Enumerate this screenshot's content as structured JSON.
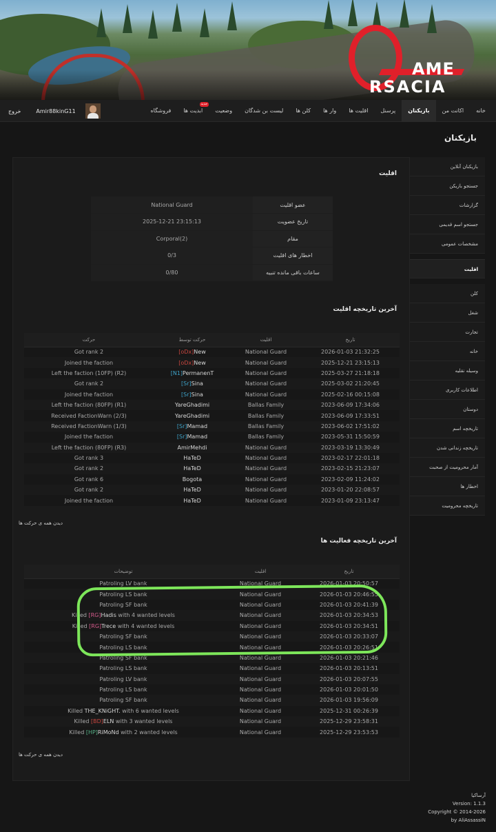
{
  "header": {
    "logo_line1": "AME",
    "logo_line2": "RSACIA"
  },
  "nav": {
    "items": [
      {
        "label": "خانه"
      },
      {
        "label": "اکانت من"
      },
      {
        "label": "بازیکنان",
        "active": true
      },
      {
        "label": "پرسنل"
      },
      {
        "label": "اقلیت ها"
      },
      {
        "label": "وار ها"
      },
      {
        "label": "کلن ها"
      },
      {
        "label": "لیست بن شدگان"
      },
      {
        "label": "وضعیت"
      },
      {
        "label": "ابدیت ها",
        "badge": "جدید"
      },
      {
        "label": "فروشگاه"
      }
    ],
    "username": "Amir88kinG11",
    "logout": "خروج"
  },
  "page_title": "بازیکنان",
  "sidebar": {
    "items_top": [
      "بازیکنان آنلاین",
      "جستجو بازیکن",
      "گزارشات",
      "جستجو اسم قدیمی",
      "مشخصات عمومی"
    ],
    "active": "اقلیت",
    "items_bottom": [
      "کلن",
      "شغل",
      "تجارت",
      "خانه",
      "وسیله نقلیه",
      "اطلاعات کاربری",
      "دوستان",
      "تاریخچه اسم",
      "تاریخچه زندانی شدن",
      "آمار محرومیت از صحبت",
      "اخطار ها",
      "تاریخچه محرومیت"
    ]
  },
  "faction": {
    "title": "اقلیت",
    "rows": [
      {
        "key": "عضو اقلیت",
        "value": "National Guard"
      },
      {
        "key": "تاریخ عضویت",
        "value": "2025-12-21 23:15:13"
      },
      {
        "key": "مقام",
        "value": "Corporal(2)"
      },
      {
        "key": "اخطار های اقلیت",
        "value": "0/3"
      },
      {
        "key": "ساعات باقی مانده تنبیه",
        "value": "0/80"
      }
    ]
  },
  "faction_history": {
    "title": "آخرین تاریخچه اقلیت",
    "headers": {
      "date": "تاریخ",
      "faction": "اقلیت",
      "by": "حرکت توسط",
      "action": "حرکت"
    },
    "rows": [
      {
        "date": "2026-01-03 21:32:25",
        "faction": "National Guard",
        "fc": "ng",
        "tag": "[oDx]",
        "tc": "tag-red",
        "name": "New",
        "action": "Got rank 2"
      },
      {
        "date": "2025-12-21 23:15:13",
        "faction": "National Guard",
        "fc": "ng",
        "tag": "[oDx]",
        "tc": "tag-red",
        "name": "New",
        "action": "Joined the faction"
      },
      {
        "date": "2025-03-27 21:18:18",
        "faction": "National Guard",
        "fc": "ng",
        "tag": "[N1]",
        "tc": "tag-cyan",
        "name": "PermanenT",
        "action": "Left the faction (10FP) (R2)"
      },
      {
        "date": "2025-03-02 21:20:45",
        "faction": "National Guard",
        "fc": "ng",
        "tag": "[Sr]",
        "tc": "tag-cyan",
        "name": "Sina",
        "action": "Got rank 2"
      },
      {
        "date": "2025-02-16 00:15:08",
        "faction": "National Guard",
        "fc": "ng",
        "tag": "[Sr]",
        "tc": "tag-cyan",
        "name": "Sina",
        "action": "Joined the faction"
      },
      {
        "date": "2023-06-09 17:34:06",
        "faction": "Ballas Family",
        "fc": "ballas",
        "tag": "",
        "tc": "",
        "name": "YareGhadimi",
        "action": "Left the faction (80FP) (R1)"
      },
      {
        "date": "2023-06-09 17:33:51",
        "faction": "Ballas Family",
        "fc": "ballas",
        "tag": "",
        "tc": "",
        "name": "YareGhadimi",
        "action": "Received FactionWarn (2/3)"
      },
      {
        "date": "2023-06-02 17:51:02",
        "faction": "Ballas Family",
        "fc": "ballas",
        "tag": "[Sr]",
        "tc": "tag-cyan",
        "name": "Mamad",
        "action": "Received FactionWarn (1/3)"
      },
      {
        "date": "2023-05-31 15:50:59",
        "faction": "Ballas Family",
        "fc": "ballas",
        "tag": "[Sr]",
        "tc": "tag-cyan",
        "name": "Mamad",
        "action": "Joined the faction"
      },
      {
        "date": "2023-03-19 13:30:49",
        "faction": "National Guard",
        "fc": "ng",
        "tag": "",
        "tc": "",
        "name": "AmirMehdi",
        "action": "Left the faction (80FP) (R3)"
      },
      {
        "date": "2023-02-17 22:01:18",
        "faction": "National Guard",
        "fc": "ng",
        "tag": "",
        "tc": "",
        "name": "HaTeD",
        "action": "Got rank 3"
      },
      {
        "date": "2023-02-15 21:23:07",
        "faction": "National Guard",
        "fc": "ng",
        "tag": "",
        "tc": "",
        "name": "HaTeD",
        "action": "Got rank 2"
      },
      {
        "date": "2023-02-09 11:24:02",
        "faction": "National Guard",
        "fc": "ng",
        "tag": "",
        "tc": "",
        "name": "Bogota",
        "action": "Got rank 6"
      },
      {
        "date": "2023-01-20 22:08:57",
        "faction": "National Guard",
        "fc": "ng",
        "tag": "",
        "tc": "",
        "name": "HaTeD",
        "action": "Got rank 2"
      },
      {
        "date": "2023-01-09 23:13:47",
        "faction": "National Guard",
        "fc": "ng",
        "tag": "",
        "tc": "",
        "name": "HaTeD",
        "action": "Joined the faction"
      }
    ],
    "see_all": "دیدن همه ی حرکت ها"
  },
  "activity_history": {
    "title": "آخرین تاریخچه فعالیت ها",
    "headers": {
      "date": "تاریخ",
      "faction": "اقلیت",
      "desc": "توضیحات"
    },
    "rows": [
      {
        "date": "2026-01-03 20:50:57",
        "faction": "National Guard",
        "pre": "Patroling LV bank",
        "tag": "",
        "tc": "",
        "name": "",
        "post": ""
      },
      {
        "date": "2026-01-03 20:46:55",
        "faction": "National Guard",
        "pre": "Patroling LS bank",
        "tag": "",
        "tc": "",
        "name": "",
        "post": ""
      },
      {
        "date": "2026-01-03 20:41:39",
        "faction": "National Guard",
        "pre": "Patroling SF bank",
        "tag": "",
        "tc": "",
        "name": "",
        "post": ""
      },
      {
        "date": "2026-01-03 20:34:53",
        "faction": "National Guard",
        "pre": "Killed ",
        "tag": "[RG]",
        "tc": "tag-pink",
        "name": "Hadis",
        "post": " with 4 wanted levels"
      },
      {
        "date": "2026-01-03 20:34:51",
        "faction": "National Guard",
        "pre": "Killed ",
        "tag": "[RG]",
        "tc": "tag-pink",
        "name": "Trece",
        "post": " with 4 wanted levels"
      },
      {
        "date": "2026-01-03 20:33:07",
        "faction": "National Guard",
        "pre": "Patroling SF bank",
        "tag": "",
        "tc": "",
        "name": "",
        "post": ""
      },
      {
        "date": "2026-01-03 20:26:51",
        "faction": "National Guard",
        "pre": "Patroling LS bank",
        "tag": "",
        "tc": "",
        "name": "",
        "post": ""
      },
      {
        "date": "2026-01-03 20:21:46",
        "faction": "National Guard",
        "pre": "Patroling SF bank",
        "tag": "",
        "tc": "",
        "name": "",
        "post": ""
      },
      {
        "date": "2026-01-03 20:13:51",
        "faction": "National Guard",
        "pre": "Patroling LS bank",
        "tag": "",
        "tc": "",
        "name": "",
        "post": ""
      },
      {
        "date": "2026-01-03 20:07:55",
        "faction": "National Guard",
        "pre": "Patroling LV bank",
        "tag": "",
        "tc": "",
        "name": "",
        "post": ""
      },
      {
        "date": "2026-01-03 20:01:50",
        "faction": "National Guard",
        "pre": "Patroling LS bank",
        "tag": "",
        "tc": "",
        "name": "",
        "post": ""
      },
      {
        "date": "2026-01-03 19:56:09",
        "faction": "National Guard",
        "pre": "Patroling SF bank",
        "tag": "",
        "tc": "",
        "name": "",
        "post": ""
      },
      {
        "date": "2025-12-31 00:26:39",
        "faction": "National Guard",
        "pre": "Killed ",
        "tag": "",
        "tc": "",
        "name": "THE_KNiGHT.",
        "post": " with 6 wanted levels"
      },
      {
        "date": "2025-12-29 23:58:31",
        "faction": "National Guard",
        "pre": "Killed ",
        "tag": "[BD]",
        "tc": "tag-red",
        "name": "ELN",
        "post": " with 3 wanted levels"
      },
      {
        "date": "2025-12-29 23:53:53",
        "faction": "National Guard",
        "pre": "Killed ",
        "tag": "[HP]",
        "tc": "tag-green",
        "name": "RiMoNd",
        "post": " with 2 wanted levels"
      }
    ],
    "see_all": "دیدن همه ی حرکت ها"
  },
  "footer": {
    "site": "آرساکیا",
    "version": "Version: 1.1.3",
    "copyright": "Copyright © 2014-2026",
    "author": "by AliAssassiN"
  },
  "colors": {
    "highlight": "#7de65a",
    "brand_red": "#e0202a",
    "national_guard": "#3b68b8",
    "ballas_family": "#9b3fd0"
  }
}
